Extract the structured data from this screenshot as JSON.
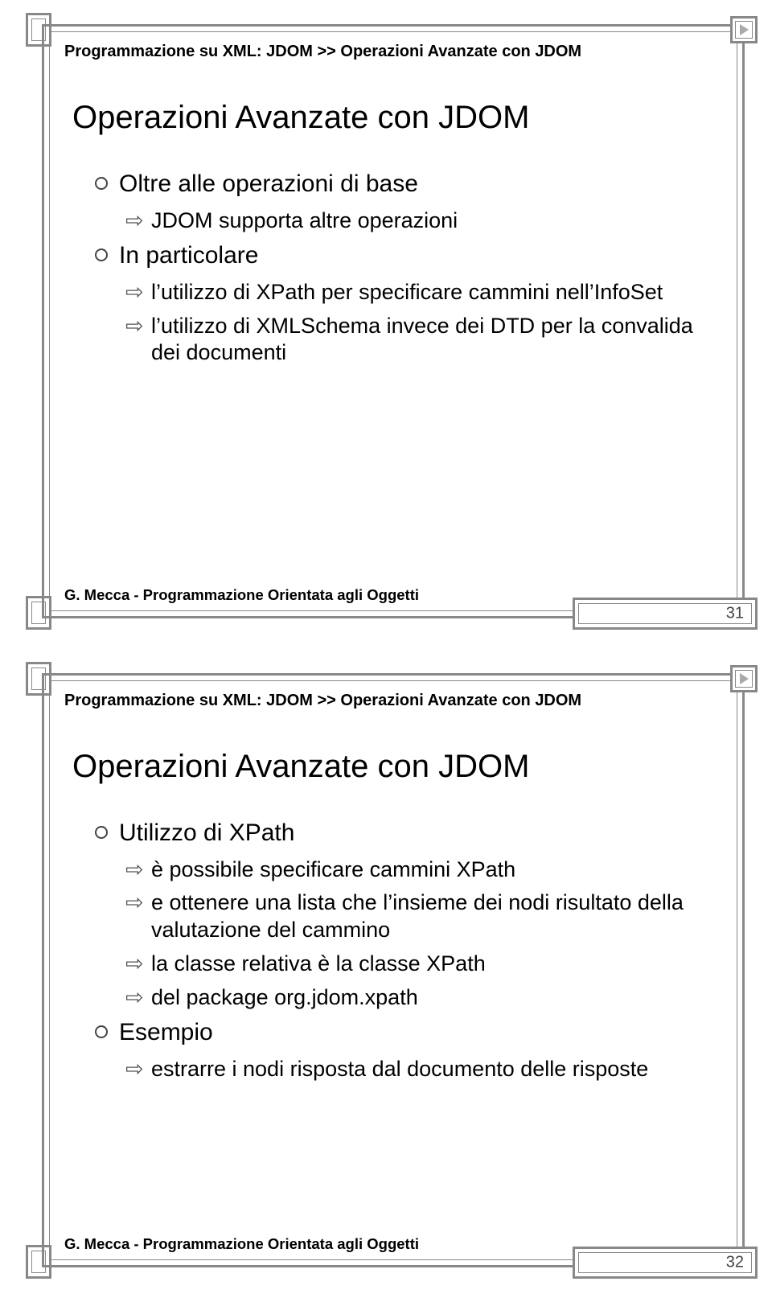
{
  "slides": [
    {
      "breadcrumb": "Programmazione su XML: JDOM >> Operazioni Avanzate con JDOM",
      "title": "Operazioni Avanzate con JDOM",
      "items": [
        {
          "level": 1,
          "text": "Oltre alle operazioni di base"
        },
        {
          "level": 2,
          "text": "JDOM supporta altre operazioni"
        },
        {
          "level": 1,
          "text": "In particolare"
        },
        {
          "level": 2,
          "text": "l’utilizzo di XPath per specificare cammini nell’InfoSet"
        },
        {
          "level": 2,
          "text": "l’utilizzo di XMLSchema invece dei DTD per la convalida dei documenti"
        }
      ],
      "footer": "G. Mecca - Programmazione Orientata agli Oggetti",
      "page": "31"
    },
    {
      "breadcrumb": "Programmazione su XML: JDOM >> Operazioni Avanzate con JDOM",
      "title": "Operazioni Avanzate con JDOM",
      "items": [
        {
          "level": 1,
          "text": "Utilizzo di XPath"
        },
        {
          "level": 2,
          "text": "è possibile specificare cammini XPath"
        },
        {
          "level": 2,
          "text": "e ottenere una lista che l’insieme dei nodi risultato della valutazione del cammino"
        },
        {
          "level": 2,
          "text": "la classe relativa è la classe XPath"
        },
        {
          "level": 2,
          "text": "del package org.jdom.xpath"
        },
        {
          "level": 1,
          "text": "Esempio"
        },
        {
          "level": 2,
          "text": "estrarre i nodi risposta dal documento delle risposte"
        }
      ],
      "footer": "G. Mecca - Programmazione Orientata agli Oggetti",
      "page": "32"
    }
  ]
}
